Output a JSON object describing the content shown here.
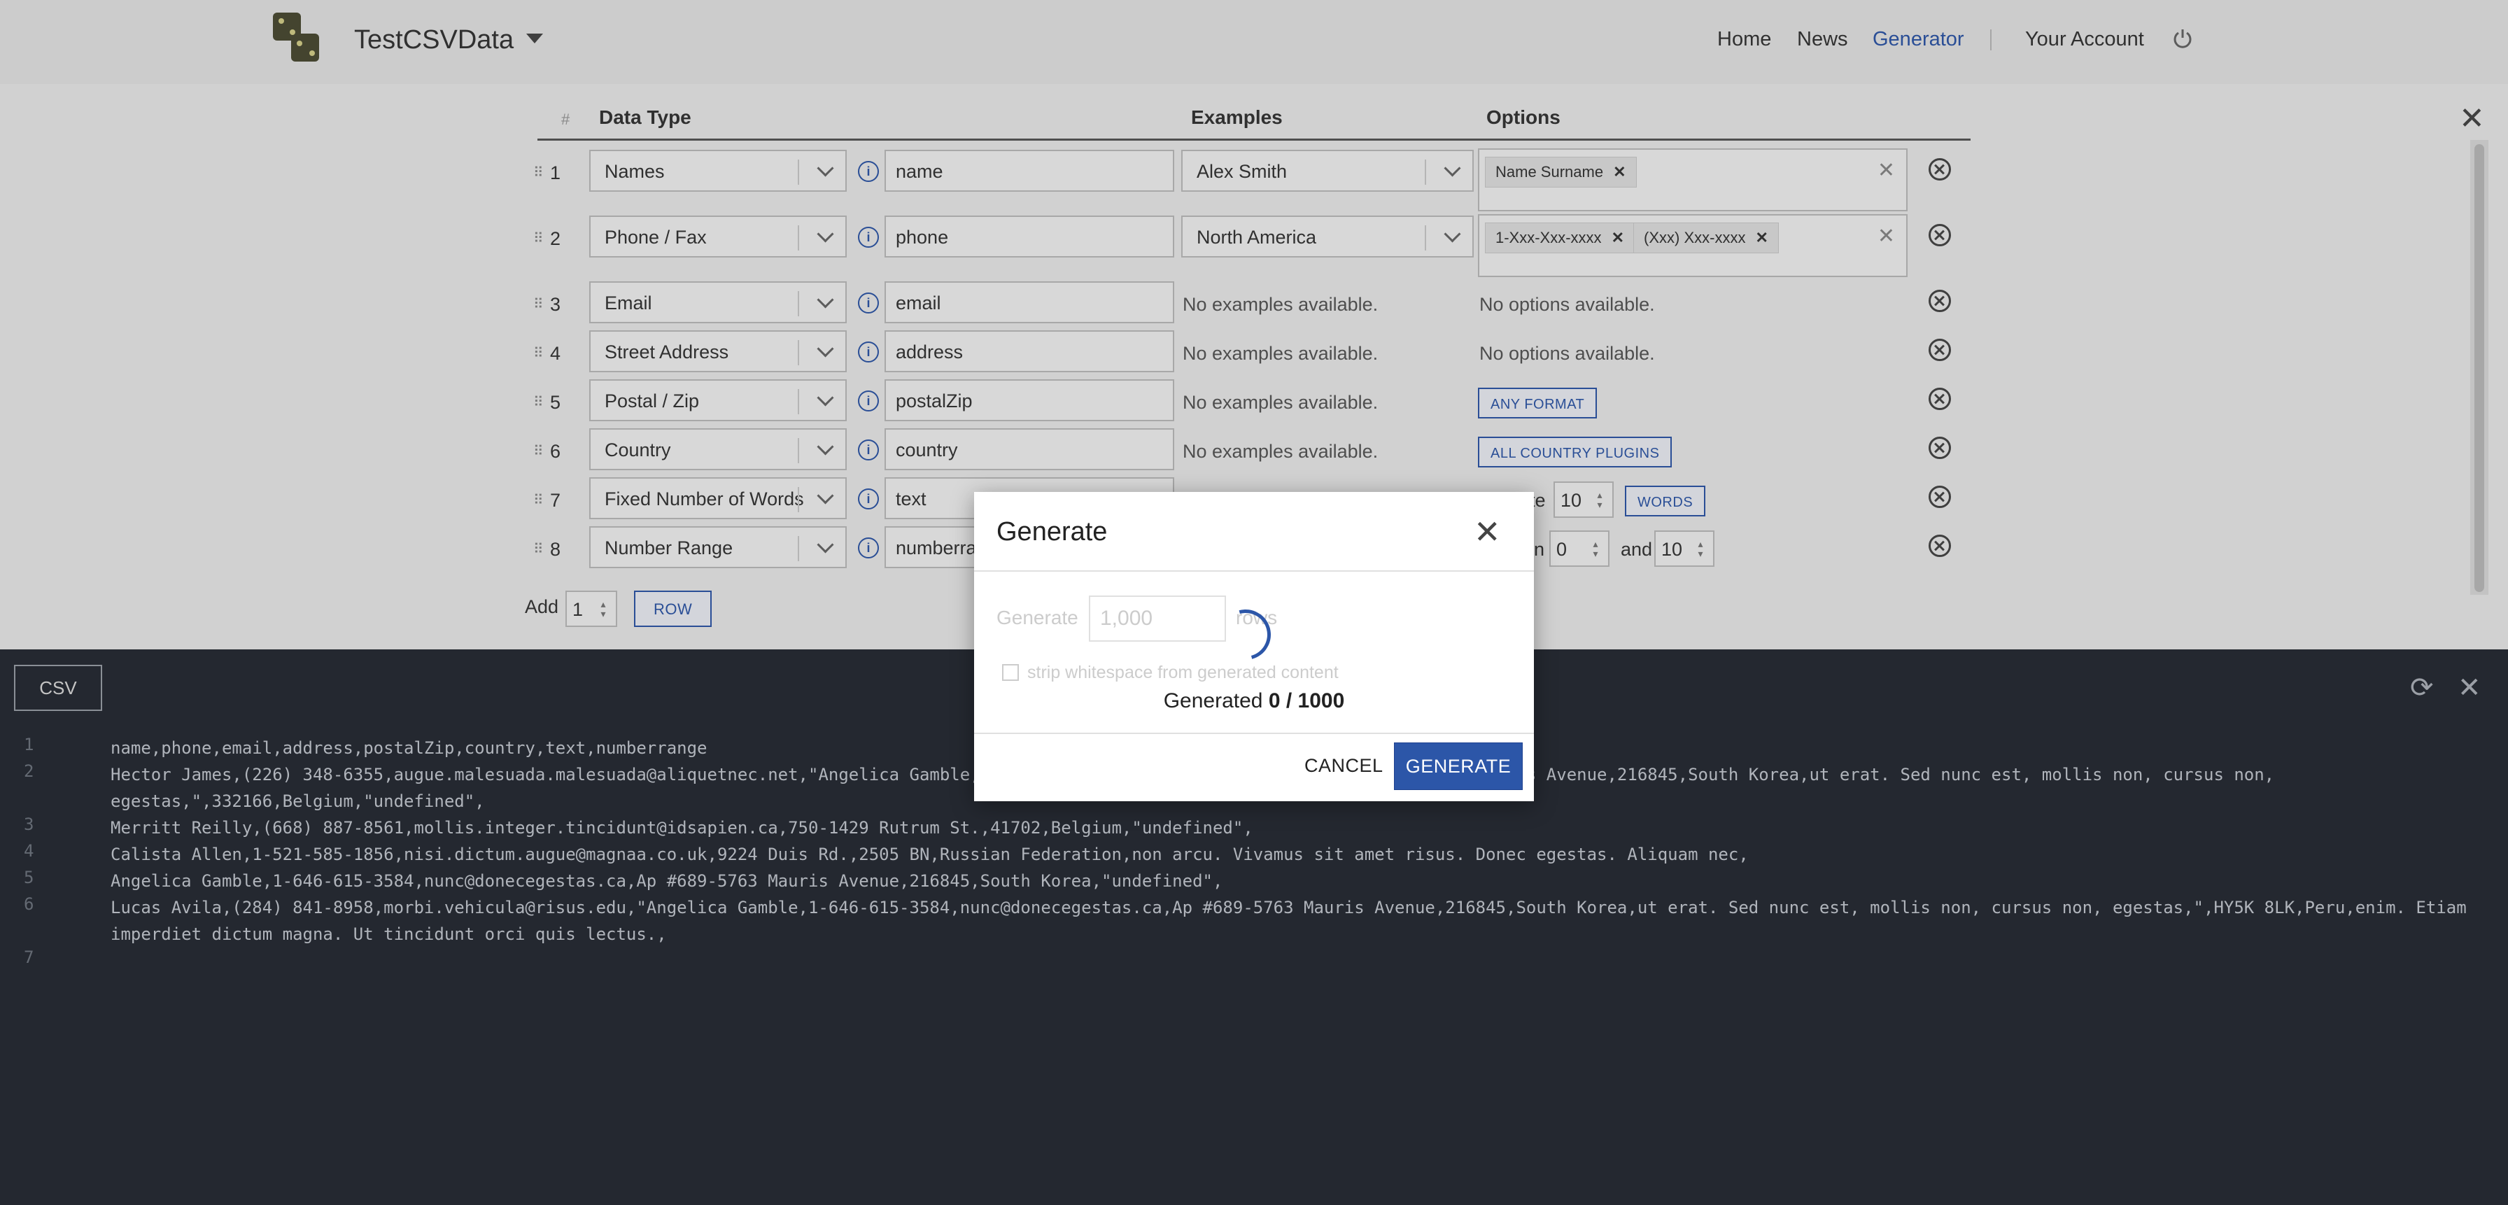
{
  "app": {
    "title": "TestCSVData"
  },
  "nav": {
    "home": "Home",
    "news": "News",
    "generator": "Generator",
    "account": "Your Account"
  },
  "grid": {
    "headers": {
      "hash": "#",
      "data_type": "Data Type",
      "examples": "Examples",
      "options": "Options"
    },
    "rows": [
      {
        "num": "1",
        "type": "Names",
        "field": "name",
        "example": "Alex Smith",
        "chips": [
          "Name Surname"
        ]
      },
      {
        "num": "2",
        "type": "Phone / Fax",
        "field": "phone",
        "example": "North America",
        "chips": [
          "1-Xxx-Xxx-xxxx",
          "(Xxx) Xxx-xxxx"
        ]
      },
      {
        "num": "3",
        "type": "Email",
        "field": "email",
        "example_text": "No examples available.",
        "option_text": "No options available."
      },
      {
        "num": "4",
        "type": "Street Address",
        "field": "address",
        "example_text": "No examples available.",
        "option_text": "No options available."
      },
      {
        "num": "5",
        "type": "Postal / Zip",
        "field": "postalZip",
        "example_text": "No examples available.",
        "option_button": "ANY FORMAT"
      },
      {
        "num": "6",
        "type": "Country",
        "field": "country",
        "example_text": "No examples available.",
        "option_button": "ALL COUNTRY PLUGINS"
      },
      {
        "num": "7",
        "type": "Fixed Number of Words",
        "field": "text",
        "option_prefix": "te",
        "option_value": "10",
        "option_button": "WORDS"
      },
      {
        "num": "8",
        "type": "Number Range",
        "field": "numberra",
        "option_prefix": "n",
        "min": "0",
        "and": "and",
        "max": "10"
      }
    ],
    "add": {
      "label": "Add",
      "value": "1",
      "button": "ROW"
    }
  },
  "panel": {
    "tab": "CSV",
    "lines": [
      {
        "n": "1",
        "text": "name,phone,email,address,postalZip,country,text,numberrange"
      },
      {
        "n": "2",
        "text": "Hector James,(226) 348-6355,augue.malesuada.malesuada@aliquetnec.net,\"Angelica Gamble,1-646-615-3584,nunc@donecegestas.ca,Ap #689-5763 Mauris Avenue,216845,South Korea,ut erat. Sed nunc est, mollis non, cursus non, egestas,\",332166,Belgium,\"undefined\","
      },
      {
        "n": "3",
        "text": "Merritt Reilly,(668) 887-8561,mollis.integer.tincidunt@idsapien.ca,750-1429 Rutrum St.,41702,Belgium,\"undefined\","
      },
      {
        "n": "4",
        "text": "Calista Allen,1-521-585-1856,nisi.dictum.augue@magnaa.co.uk,9224 Duis Rd.,2505 BN,Russian Federation,non arcu. Vivamus sit amet risus. Donec egestas. Aliquam nec,"
      },
      {
        "n": "5",
        "text": "Angelica Gamble,1-646-615-3584,nunc@donecegestas.ca,Ap #689-5763 Mauris Avenue,216845,South Korea,\"undefined\","
      },
      {
        "n": "6",
        "text": "Lucas Avila,(284) 841-8958,morbi.vehicula@risus.edu,\"Angelica Gamble,1-646-615-3584,nunc@donecegestas.ca,Ap #689-5763 Mauris Avenue,216845,South Korea,ut erat. Sed nunc est, mollis non, cursus non, egestas,\",HY5K 8LK,Peru,enim. Etiam imperdiet dictum magna. Ut tincidunt orci quis lectus.,"
      },
      {
        "n": "7",
        "text": ""
      }
    ]
  },
  "modal": {
    "title": "Generate",
    "gen_label": "Generate",
    "rows_value": "1,000",
    "rows_label": "rows",
    "strip_label": "strip whitespace from generated content",
    "progress_label": "Generated",
    "progress_value": "0 / 1000",
    "cancel": "CANCEL",
    "generate": "GENERATE"
  },
  "colors": {
    "accent": "#2c56a8",
    "panel_bg": "#252a33"
  }
}
